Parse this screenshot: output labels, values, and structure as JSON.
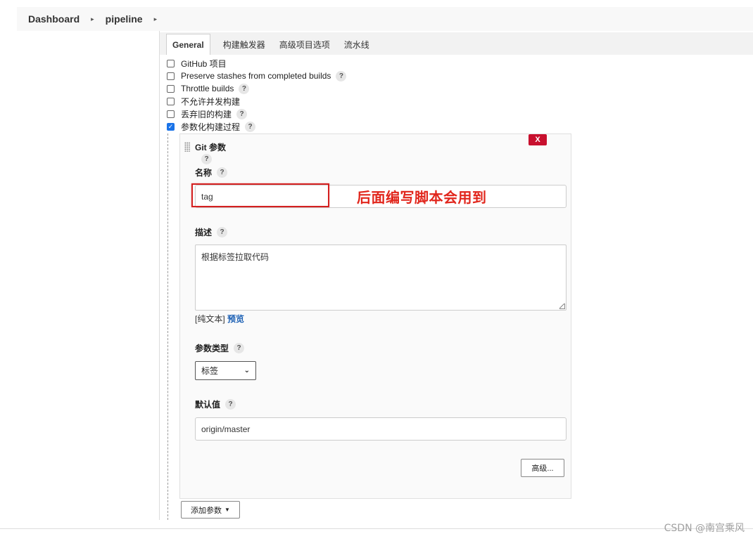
{
  "breadcrumb": {
    "items": [
      "Dashboard",
      "pipeline"
    ]
  },
  "tabs": [
    "General",
    "构建触发器",
    "高级项目选项",
    "流水线"
  ],
  "options": [
    {
      "label": "GitHub 项目",
      "checked": false,
      "help": false
    },
    {
      "label": "Preserve stashes from completed builds",
      "checked": false,
      "help": true
    },
    {
      "label": "Throttle builds",
      "checked": false,
      "help": true
    },
    {
      "label": "不允许并发构建",
      "checked": false,
      "help": false
    },
    {
      "label": "丢弃旧的构建",
      "checked": false,
      "help": true
    },
    {
      "label": "参数化构建过程",
      "checked": true,
      "help": true
    }
  ],
  "help_symbol": "?",
  "param": {
    "delete_label": "X",
    "title": "Git 参数",
    "name_label": "名称",
    "name_value": "tag",
    "desc_label": "描述",
    "desc_value": "根据标签拉取代码",
    "format_plain": "[纯文本]",
    "format_preview": "预览",
    "type_label": "参数类型",
    "type_value": "标签",
    "default_label": "默认值",
    "default_value": "origin/master",
    "advanced_label": "高级..."
  },
  "add_param_label": "添加参数",
  "annotation": "后面编写脚本会用到",
  "watermark": "CSDN @南宫乘风",
  "colors": {
    "accent_blue": "#1a73e8",
    "delete_red": "#c8102e",
    "annotation_red": "#e1261c"
  }
}
